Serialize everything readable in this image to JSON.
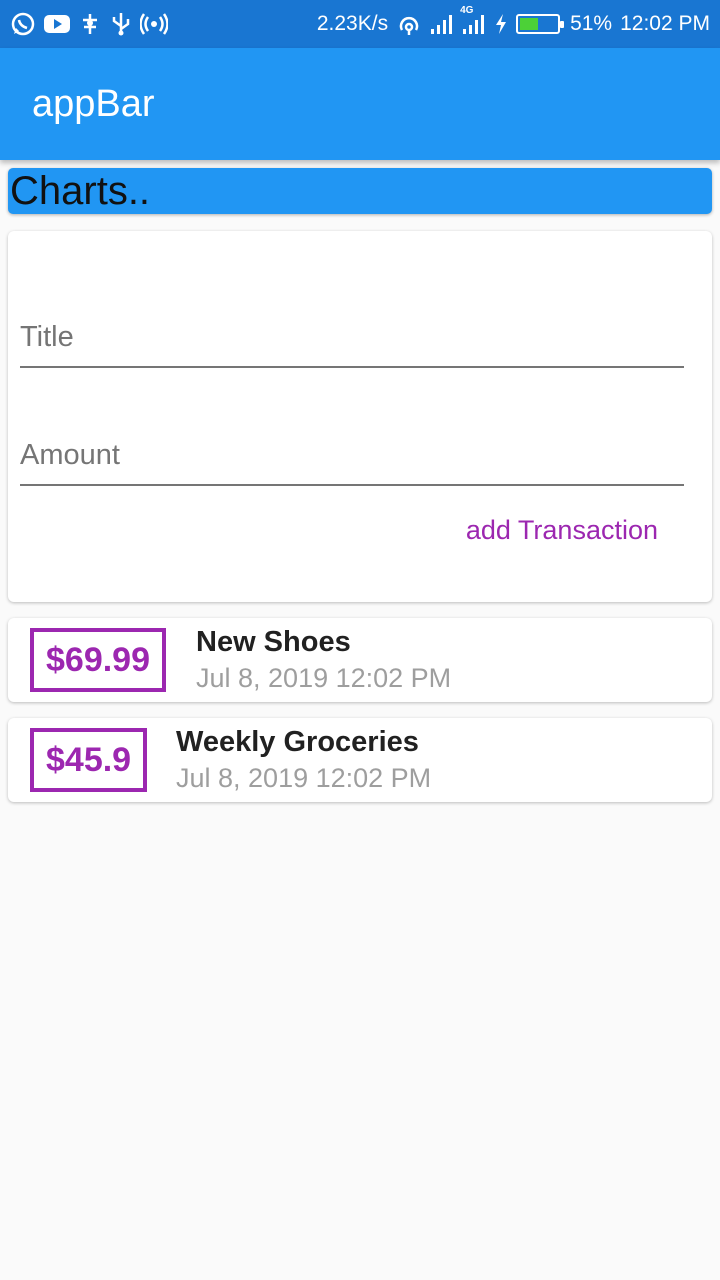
{
  "status_bar": {
    "speed": "2.23K/s",
    "network": "4G",
    "battery": "51%",
    "time": "12:02 PM",
    "icons": [
      "whatsapp-icon",
      "youtube-icon",
      "usb-debug-icon",
      "usb-icon",
      "hotspot-icon",
      "wifi-icon",
      "signal-icon",
      "signal-4g-icon",
      "charging-icon",
      "battery-icon"
    ]
  },
  "appbar": {
    "title": "appBar"
  },
  "charts": {
    "label": "Charts.."
  },
  "form": {
    "title_placeholder": "Title",
    "amount_placeholder": "Amount",
    "add_button": "add Transaction"
  },
  "transactions": [
    {
      "amount": "$69.99",
      "title": "New Shoes",
      "date": "Jul 8, 2019 12:02 PM"
    },
    {
      "amount": "$45.9",
      "title": "Weekly Groceries",
      "date": "Jul 8, 2019 12:02 PM"
    }
  ],
  "colors": {
    "primary": "#2196f3",
    "status_bar": "#1976d2",
    "accent": "#9c27b0",
    "battery_fill": "#4cd137"
  }
}
